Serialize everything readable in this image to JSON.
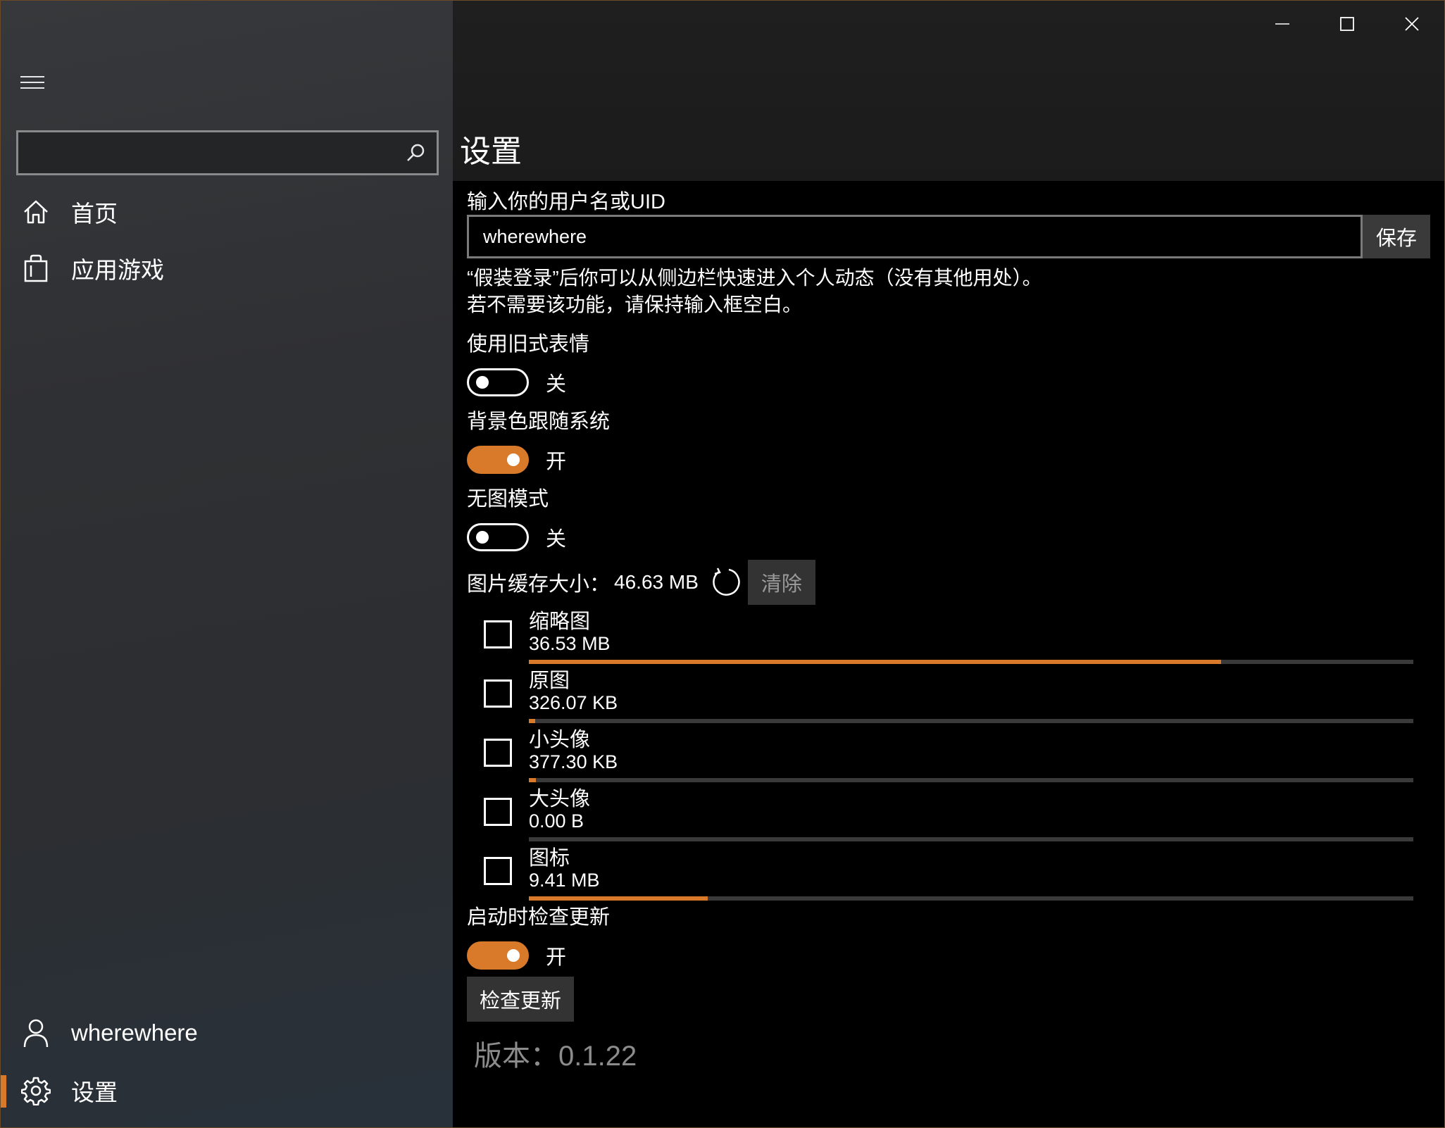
{
  "window": {
    "controls": {
      "minimize": "minimize",
      "maximize": "maximize",
      "close": "close"
    }
  },
  "sidebar": {
    "search": {
      "value": "",
      "placeholder": ""
    },
    "nav": [
      {
        "id": "home",
        "label": "首页",
        "icon": "home-icon"
      },
      {
        "id": "games",
        "label": "应用游戏",
        "icon": "shopping-bag-icon"
      }
    ],
    "user": {
      "label": "wherewhere",
      "icon": "person-icon"
    },
    "settings": {
      "label": "设置",
      "icon": "gear-icon",
      "selected": true
    }
  },
  "page": {
    "title": "设置"
  },
  "settings": {
    "uid_label": "输入你的用户名或UID",
    "uid_value": "wherewhere",
    "save_label": "保存",
    "hint_line1": "“假装登录”后你可以从侧边栏快速进入个人动态（没有其他用处）。",
    "hint_line2": "若不需要该功能，请保持输入框空白。",
    "old_emoji": {
      "label": "使用旧式表情",
      "state": "关",
      "on": false
    },
    "bg_follow_system": {
      "label": "背景色跟随系统",
      "state": "开",
      "on": true
    },
    "no_image_mode": {
      "label": "无图模式",
      "state": "关",
      "on": false
    },
    "cache": {
      "label": "图片缓存大小：",
      "total": "46.63 MB",
      "clear_label": "清除",
      "items": [
        {
          "name": "缩略图",
          "size": "36.53 MB",
          "fraction": 0.783
        },
        {
          "name": "原图",
          "size": "326.07 KB",
          "fraction": 0.007
        },
        {
          "name": "小头像",
          "size": "377.30 KB",
          "fraction": 0.008
        },
        {
          "name": "大头像",
          "size": "0.00 B",
          "fraction": 0.0
        },
        {
          "name": "图标",
          "size": "9.41 MB",
          "fraction": 0.202
        }
      ]
    },
    "check_on_start": {
      "label": "启动时检查更新",
      "state": "开",
      "on": true
    },
    "check_update_label": "检查更新",
    "version": "版本：0.1.22"
  },
  "colors": {
    "accent": "#d97a2b",
    "sidebar_bg": "#2f3033",
    "content_bg": "#000000"
  }
}
